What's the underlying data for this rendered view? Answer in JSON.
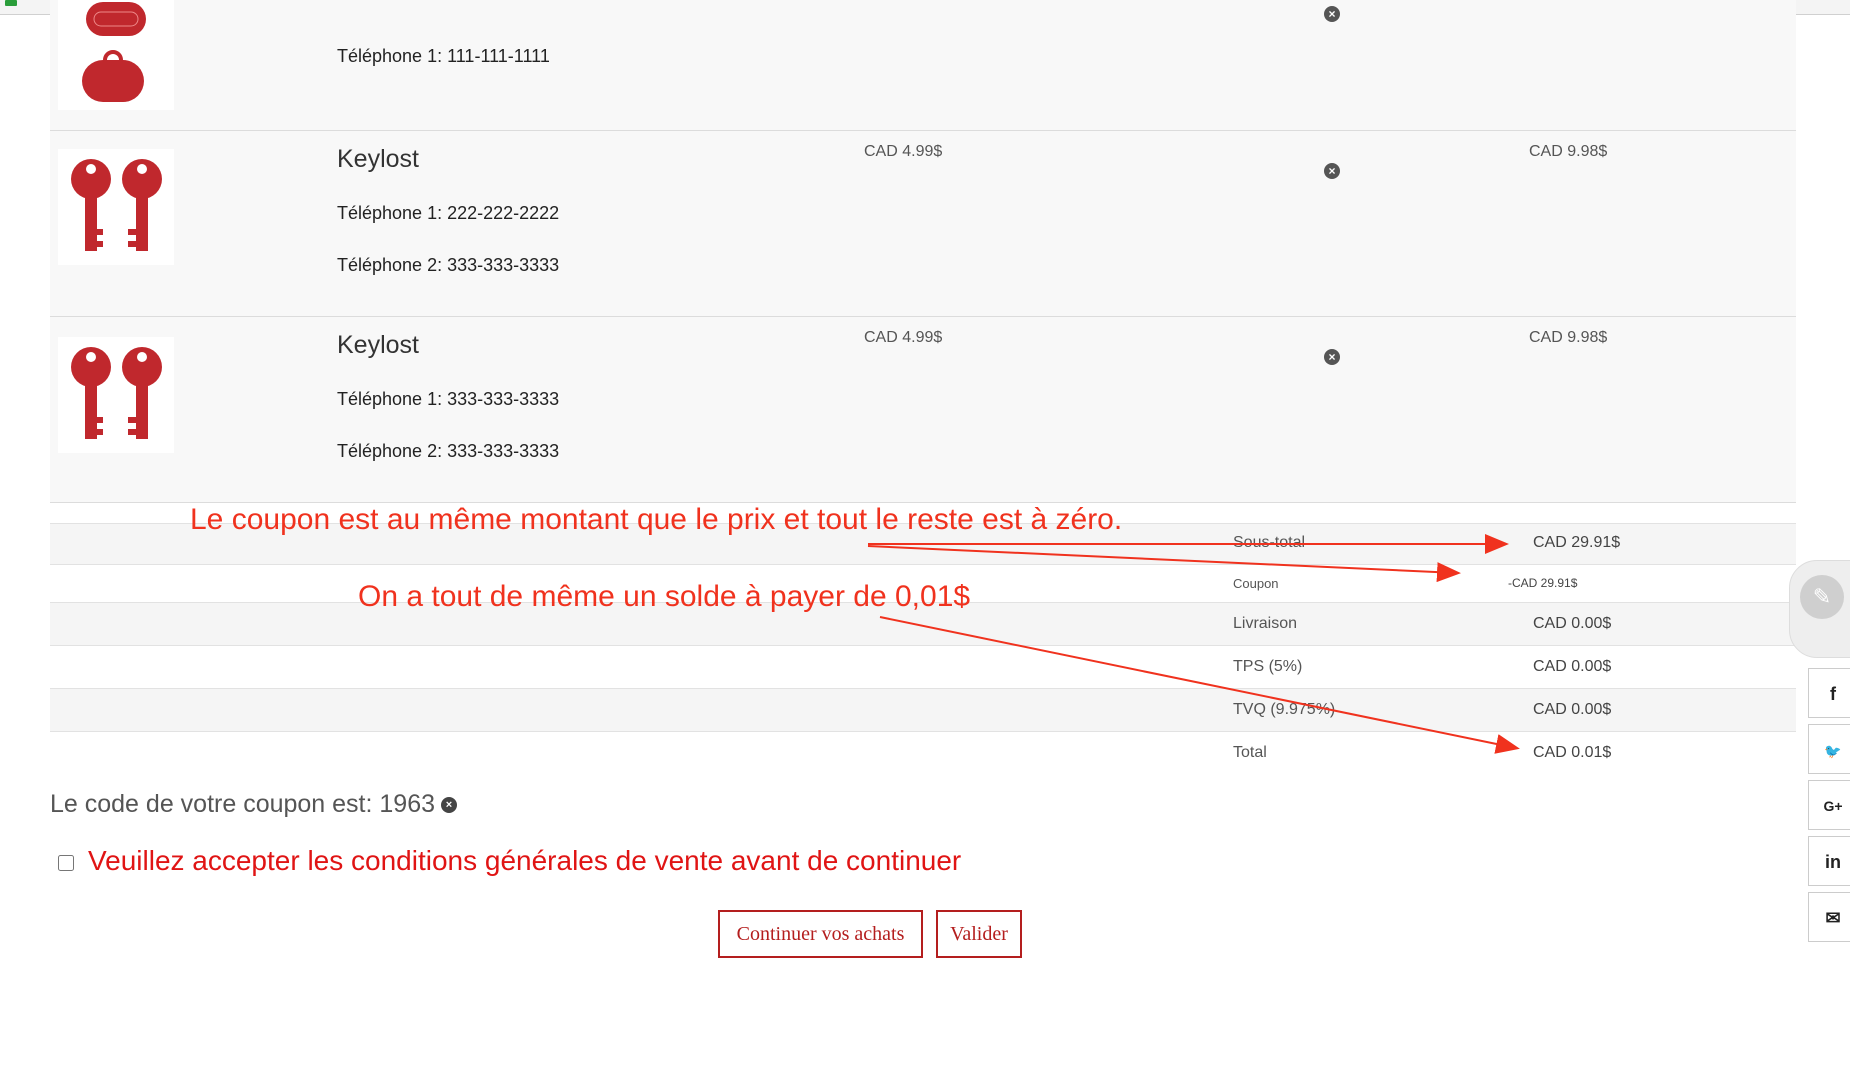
{
  "items": [
    {
      "phones": [
        "Téléphone 1: 111-111-1111"
      ]
    },
    {
      "name": "Keylost",
      "price": "CAD 4.99$",
      "total": "CAD 9.98$",
      "phones": [
        "Téléphone 1: 222-222-2222",
        "Téléphone 2: 333-333-3333"
      ]
    },
    {
      "name": "Keylost",
      "price": "CAD 4.99$",
      "total": "CAD 9.98$",
      "phones": [
        "Téléphone 1: 333-333-3333",
        "Téléphone 2: 333-333-3333"
      ]
    }
  ],
  "item_remove_icon": "x-circle-icon",
  "summary": [
    {
      "label": "Sous-total",
      "value": "CAD 29.91$"
    },
    {
      "label": "Coupon",
      "value": "-CAD 29.91$"
    },
    {
      "label": "Livraison",
      "value": "CAD 0.00$"
    },
    {
      "label": "TPS (5%)",
      "value": "CAD 0.00$"
    },
    {
      "label": "TVQ (9.975%)",
      "value": "CAD 0.00$"
    },
    {
      "label": "Total",
      "value": "CAD 0.01$"
    }
  ],
  "annotations": {
    "line1": "Le coupon est au même montant que le prix et tout le reste est à zéro.",
    "line2": "On a tout de même un solde à payer de 0,01$",
    "color": "#f0321e"
  },
  "coupon": {
    "label": "Le code de votre coupon est: 1963"
  },
  "terms": {
    "label": "Veuillez accepter les conditions générales de vente avant de continuer"
  },
  "buttons": {
    "continue": "Continuer vos achats",
    "validate": "Valider"
  },
  "social": {
    "facebook": "f",
    "twitter": "🐦",
    "googleplus": "G+",
    "linkedin": "in",
    "email": "✉"
  },
  "colors": {
    "accent": "#b41e1e",
    "warning": "#e01414"
  }
}
